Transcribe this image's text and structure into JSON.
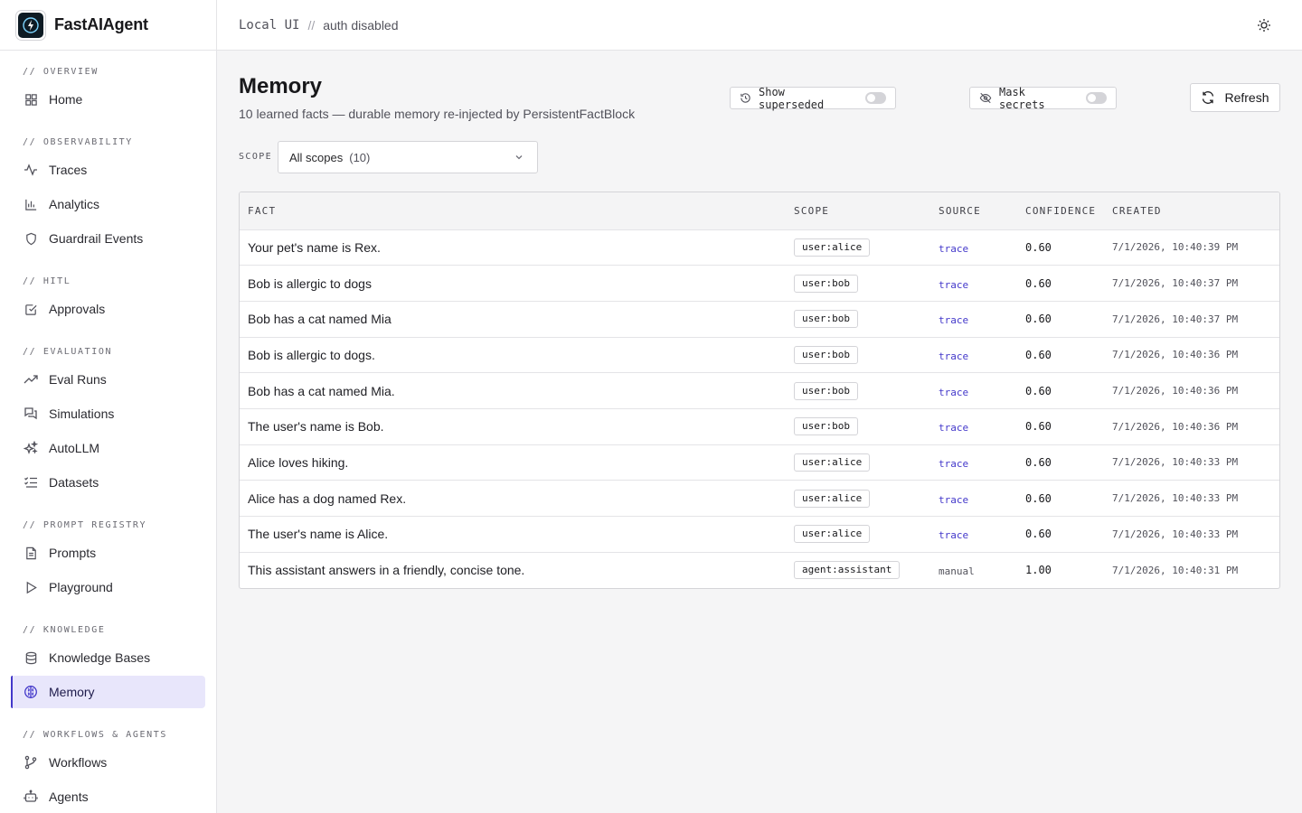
{
  "app": {
    "name": "FastAIAgent"
  },
  "topbar": {
    "env": "Local UI",
    "separator": "//",
    "auth": "auth disabled"
  },
  "sidebar": {
    "sections": [
      {
        "title": "// OVERVIEW",
        "items": [
          {
            "label": "Home",
            "icon": "home-grid-icon"
          }
        ]
      },
      {
        "title": "// OBSERVABILITY",
        "items": [
          {
            "label": "Traces",
            "icon": "activity-icon"
          },
          {
            "label": "Analytics",
            "icon": "bar-chart-icon"
          },
          {
            "label": "Guardrail Events",
            "icon": "shield-icon"
          }
        ]
      },
      {
        "title": "// HITL",
        "items": [
          {
            "label": "Approvals",
            "icon": "check-square-icon"
          }
        ]
      },
      {
        "title": "// EVALUATION",
        "items": [
          {
            "label": "Eval Runs",
            "icon": "trending-up-icon"
          },
          {
            "label": "Simulations",
            "icon": "chat-bubbles-icon"
          },
          {
            "label": "AutoLLM",
            "icon": "sparkles-icon"
          },
          {
            "label": "Datasets",
            "icon": "list-checks-icon"
          }
        ]
      },
      {
        "title": "// PROMPT REGISTRY",
        "items": [
          {
            "label": "Prompts",
            "icon": "file-text-icon"
          },
          {
            "label": "Playground",
            "icon": "play-icon"
          }
        ]
      },
      {
        "title": "// KNOWLEDGE",
        "items": [
          {
            "label": "Knowledge Bases",
            "icon": "database-icon"
          },
          {
            "label": "Memory",
            "icon": "brain-icon",
            "active": true
          }
        ]
      },
      {
        "title": "// WORKFLOWS & AGENTS",
        "items": [
          {
            "label": "Workflows",
            "icon": "git-branch-icon"
          },
          {
            "label": "Agents",
            "icon": "bot-icon"
          }
        ]
      }
    ]
  },
  "page": {
    "title": "Memory",
    "subtitle": "10 learned facts — durable memory re-injected by PersistentFactBlock",
    "show_superseded_label": "Show superseded",
    "mask_secrets_label": "Mask secrets",
    "refresh_label": "Refresh",
    "scope_label": "SCOPE",
    "scope_selected": "All scopes",
    "scope_count": "(10)"
  },
  "table": {
    "headers": [
      "FACT",
      "SCOPE",
      "SOURCE",
      "CONFIDENCE",
      "CREATED"
    ],
    "rows": [
      {
        "fact": "Your pet's name is Rex.",
        "scope": "user:alice",
        "source": "trace",
        "confidence": "0.60",
        "created": "7/1/2026, 10:40:39 PM"
      },
      {
        "fact": "Bob is allergic to dogs",
        "scope": "user:bob",
        "source": "trace",
        "confidence": "0.60",
        "created": "7/1/2026, 10:40:37 PM"
      },
      {
        "fact": "Bob has a cat named Mia",
        "scope": "user:bob",
        "source": "trace",
        "confidence": "0.60",
        "created": "7/1/2026, 10:40:37 PM"
      },
      {
        "fact": "Bob is allergic to dogs.",
        "scope": "user:bob",
        "source": "trace",
        "confidence": "0.60",
        "created": "7/1/2026, 10:40:36 PM"
      },
      {
        "fact": "Bob has a cat named Mia.",
        "scope": "user:bob",
        "source": "trace",
        "confidence": "0.60",
        "created": "7/1/2026, 10:40:36 PM"
      },
      {
        "fact": "The user's name is Bob.",
        "scope": "user:bob",
        "source": "trace",
        "confidence": "0.60",
        "created": "7/1/2026, 10:40:36 PM"
      },
      {
        "fact": "Alice loves hiking.",
        "scope": "user:alice",
        "source": "trace",
        "confidence": "0.60",
        "created": "7/1/2026, 10:40:33 PM"
      },
      {
        "fact": "Alice has a dog named Rex.",
        "scope": "user:alice",
        "source": "trace",
        "confidence": "0.60",
        "created": "7/1/2026, 10:40:33 PM"
      },
      {
        "fact": "The user's name is Alice.",
        "scope": "user:alice",
        "source": "trace",
        "confidence": "0.60",
        "created": "7/1/2026, 10:40:33 PM"
      },
      {
        "fact": "This assistant answers in a friendly, concise tone.",
        "scope": "agent:assistant",
        "source": "manual",
        "confidence": "1.00",
        "created": "7/1/2026, 10:40:31 PM"
      }
    ]
  },
  "colors": {
    "accent": "#4338ca",
    "active_bg": "#e8e6fb",
    "border": "#d4d4d8"
  }
}
